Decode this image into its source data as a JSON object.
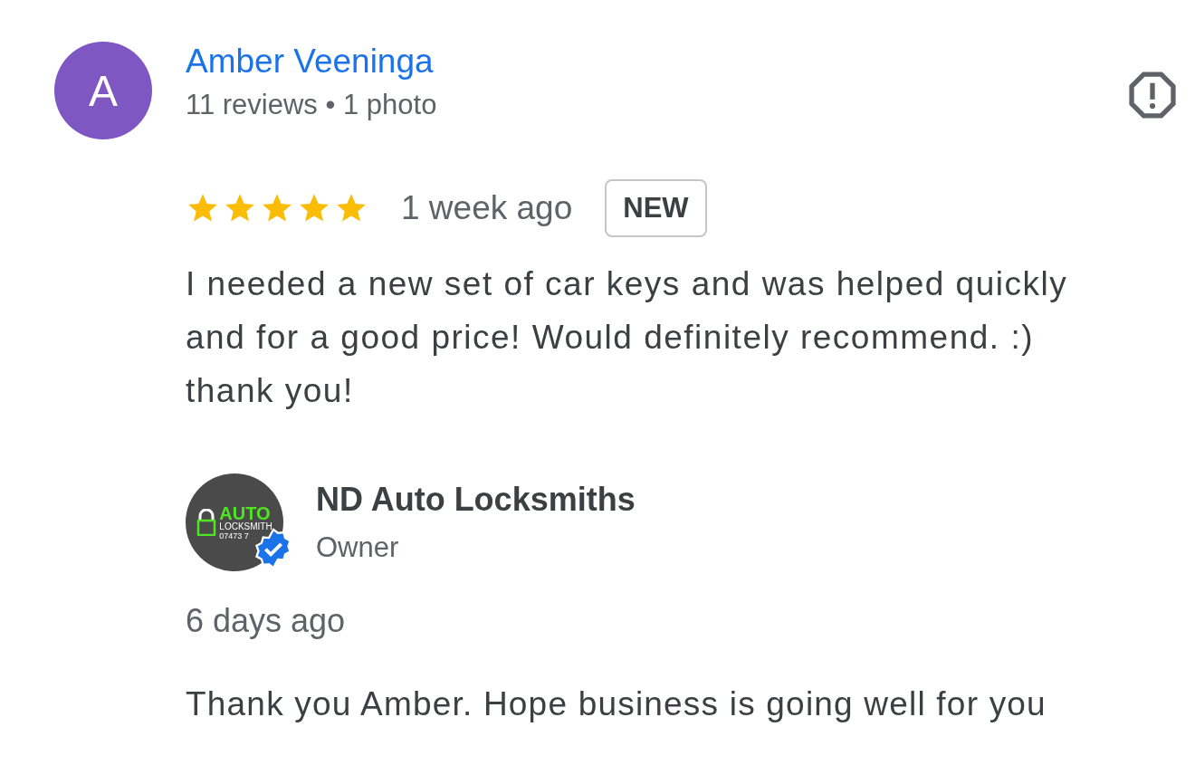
{
  "review": {
    "avatar_letter": "A",
    "author": "Amber Veeninga",
    "meta": "11 reviews • 1 photo",
    "stars": 5,
    "time": "1 week ago",
    "badge": "NEW",
    "text": "I needed a new set of car keys and was helped quickly and for a good price! Would definitely recommend. :) thank you!"
  },
  "reply": {
    "logo": {
      "word": "AUTO",
      "subtitle": "LOCKSMITH",
      "phone": "07473 7"
    },
    "verified": true,
    "name": "ND Auto Locksmiths",
    "role": "Owner",
    "time": "6 days ago",
    "text": "Thank you Amber. Hope business is going well for you"
  }
}
